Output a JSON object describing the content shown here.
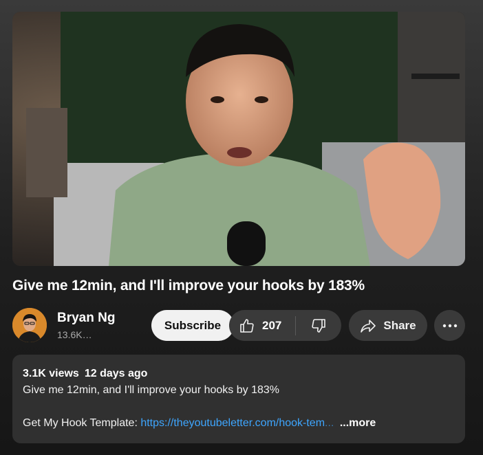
{
  "video": {
    "title": "Give me 12min, and I'll improve your hooks by 183%",
    "thumbnail_icon": "video-frame"
  },
  "channel": {
    "name": "Bryan Ng",
    "subscribers": "13.6K…"
  },
  "actions": {
    "subscribe_label": "Subscribe",
    "like_count": "207",
    "share_label": "Share"
  },
  "description": {
    "views": "3.1K views",
    "age": "12 days ago",
    "summary": "Give me 12min, and I'll improve your hooks by 183%",
    "template_prefix": "Get My Hook Template: ",
    "template_link": "https://theyoutubeletter.com/hook-tem",
    "template_ellipsis": "...",
    "more_label": "...more"
  },
  "colors": {
    "link": "#3ea6ff",
    "button_bg": "#3a3a3a",
    "subscribe_bg": "#f1f1f1"
  }
}
